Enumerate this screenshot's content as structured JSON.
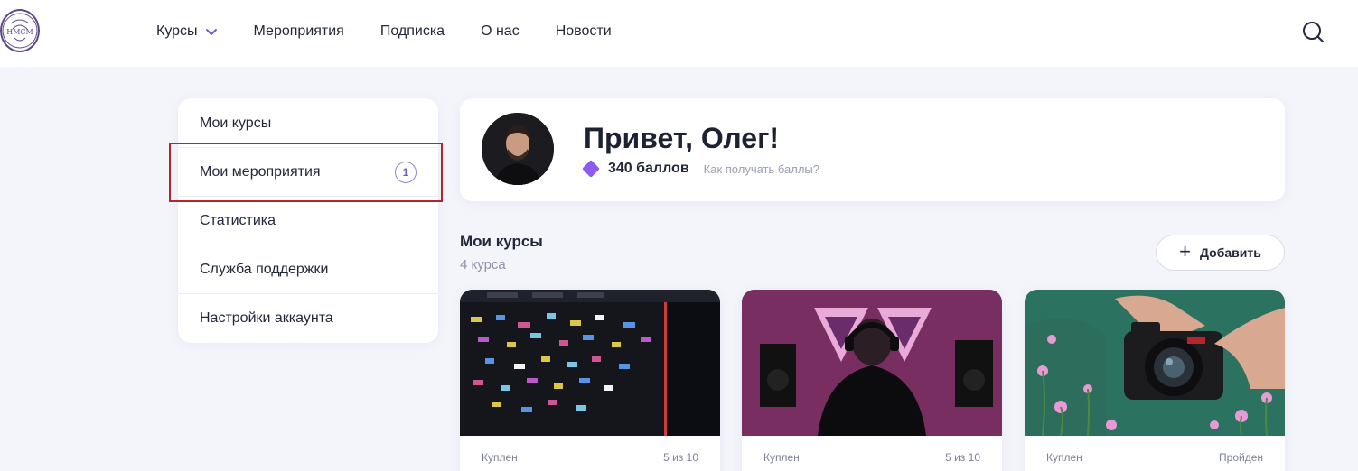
{
  "brand": {
    "logo_text": "HMCM"
  },
  "nav": {
    "items": [
      {
        "label": "Курсы",
        "dropdown": true
      },
      {
        "label": "Мероприятия"
      },
      {
        "label": "Подписка"
      },
      {
        "label": "О нас"
      },
      {
        "label": "Новости"
      }
    ],
    "search_icon": "search-icon"
  },
  "sidebar": {
    "items": [
      {
        "label": "Мои курсы"
      },
      {
        "label": "Мои мероприятия",
        "badge": "1"
      },
      {
        "label": "Статистика"
      },
      {
        "label": "Служба поддержки"
      },
      {
        "label": "Настройки аккаунта"
      }
    ]
  },
  "profile": {
    "greeting": "Привет, Олег!",
    "points": "340 баллов",
    "points_help": "Как получать баллы?",
    "gem_color": "#8c5cf0"
  },
  "courses": {
    "title": "Мои курсы",
    "count": "4 курса",
    "add_label": "Добавить",
    "cards": [
      {
        "status": "Куплен",
        "progress": "5 из 10"
      },
      {
        "status": "Куплен",
        "progress": "5 из 10"
      },
      {
        "status": "Куплен",
        "progress": "Пройден"
      }
    ]
  },
  "colors": {
    "accent": "#6b5fc7",
    "highlight": "#b3262c",
    "page_bg": "#f4f4fb"
  }
}
